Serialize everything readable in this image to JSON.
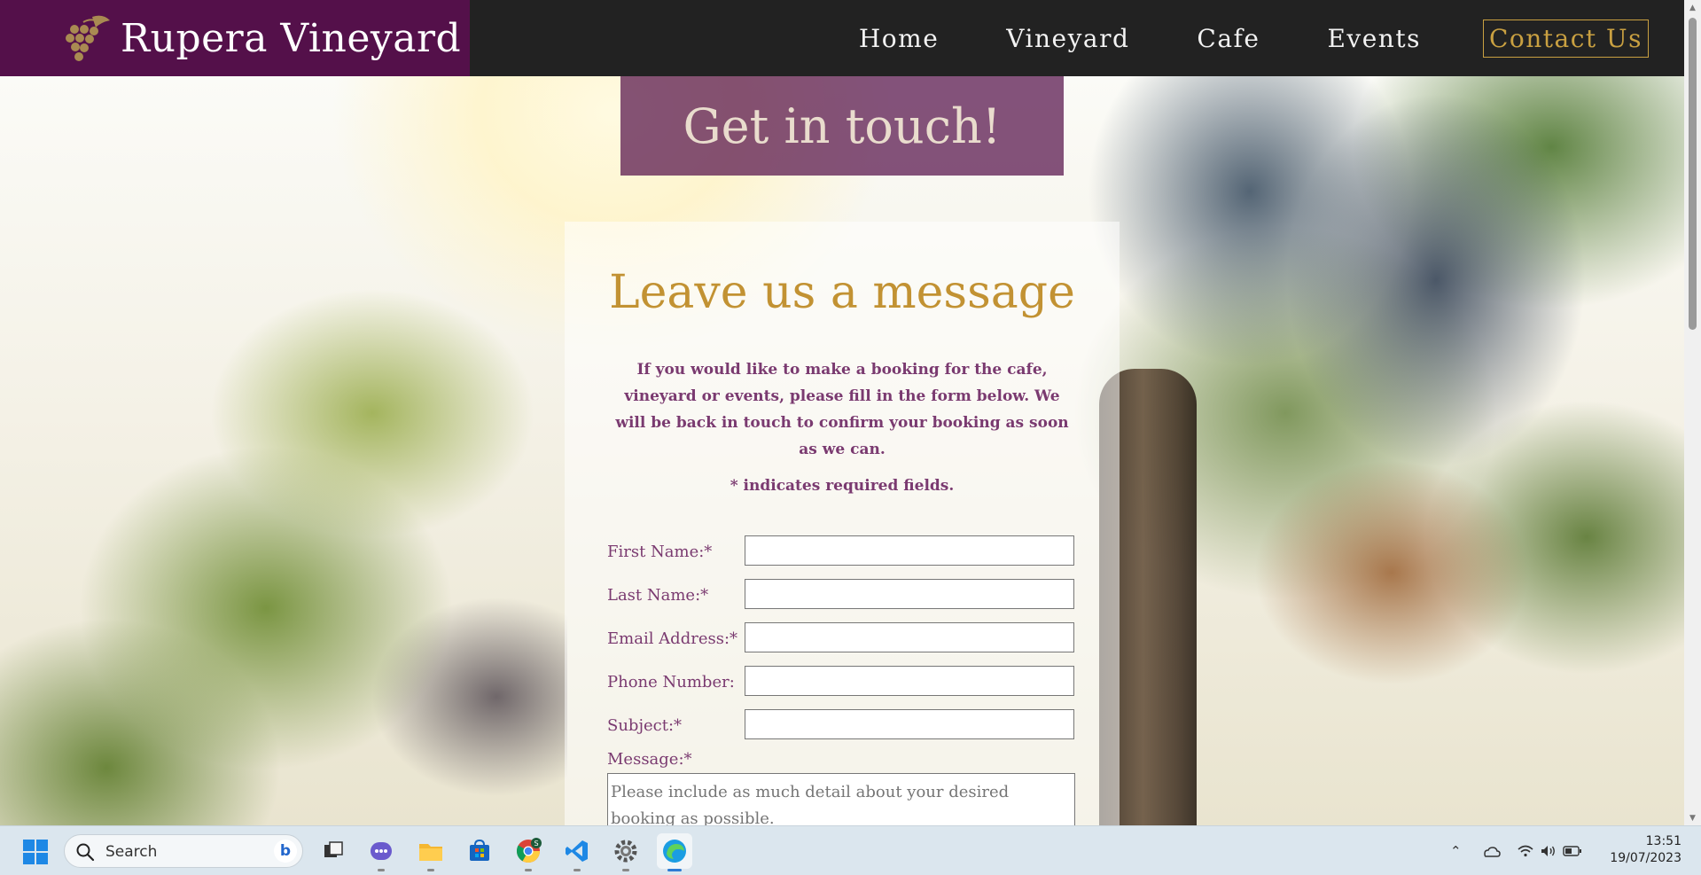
{
  "site": {
    "brand_name": "Rupera Vineyard",
    "brand_color": "#54104a",
    "accent_color": "#c9a041"
  },
  "nav": {
    "items": [
      {
        "label": "Home",
        "active": false
      },
      {
        "label": "Vineyard",
        "active": false
      },
      {
        "label": "Cafe",
        "active": false
      },
      {
        "label": "Events",
        "active": false
      },
      {
        "label": "Contact Us",
        "active": true
      }
    ]
  },
  "hero": {
    "title": "Get in touch!"
  },
  "form": {
    "heading": "Leave us a message",
    "intro": "If you would like to make a booking for the cafe, vineyard or events, please fill in the form below. We will be back in touch to confirm your booking as soon as we can.",
    "required_note": "* indicates required fields.",
    "fields": [
      {
        "label": "First Name:*",
        "value": ""
      },
      {
        "label": "Last Name:*",
        "value": ""
      },
      {
        "label": "Email Address:*",
        "value": ""
      },
      {
        "label": "Phone Number:",
        "value": ""
      },
      {
        "label": "Subject:*",
        "value": ""
      }
    ],
    "message_label": "Message:*",
    "message_placeholder": "Please include as much detail about your desired booking as possible."
  },
  "taskbar": {
    "search_placeholder": "Search",
    "apps": [
      {
        "name": "task-view-icon"
      },
      {
        "name": "teams-chat-icon"
      },
      {
        "name": "file-explorer-icon"
      },
      {
        "name": "microsoft-store-icon"
      },
      {
        "name": "chrome-icon"
      },
      {
        "name": "vscode-icon"
      },
      {
        "name": "settings-icon"
      },
      {
        "name": "edge-icon"
      }
    ],
    "time": "13:51",
    "date": "19/07/2023"
  }
}
